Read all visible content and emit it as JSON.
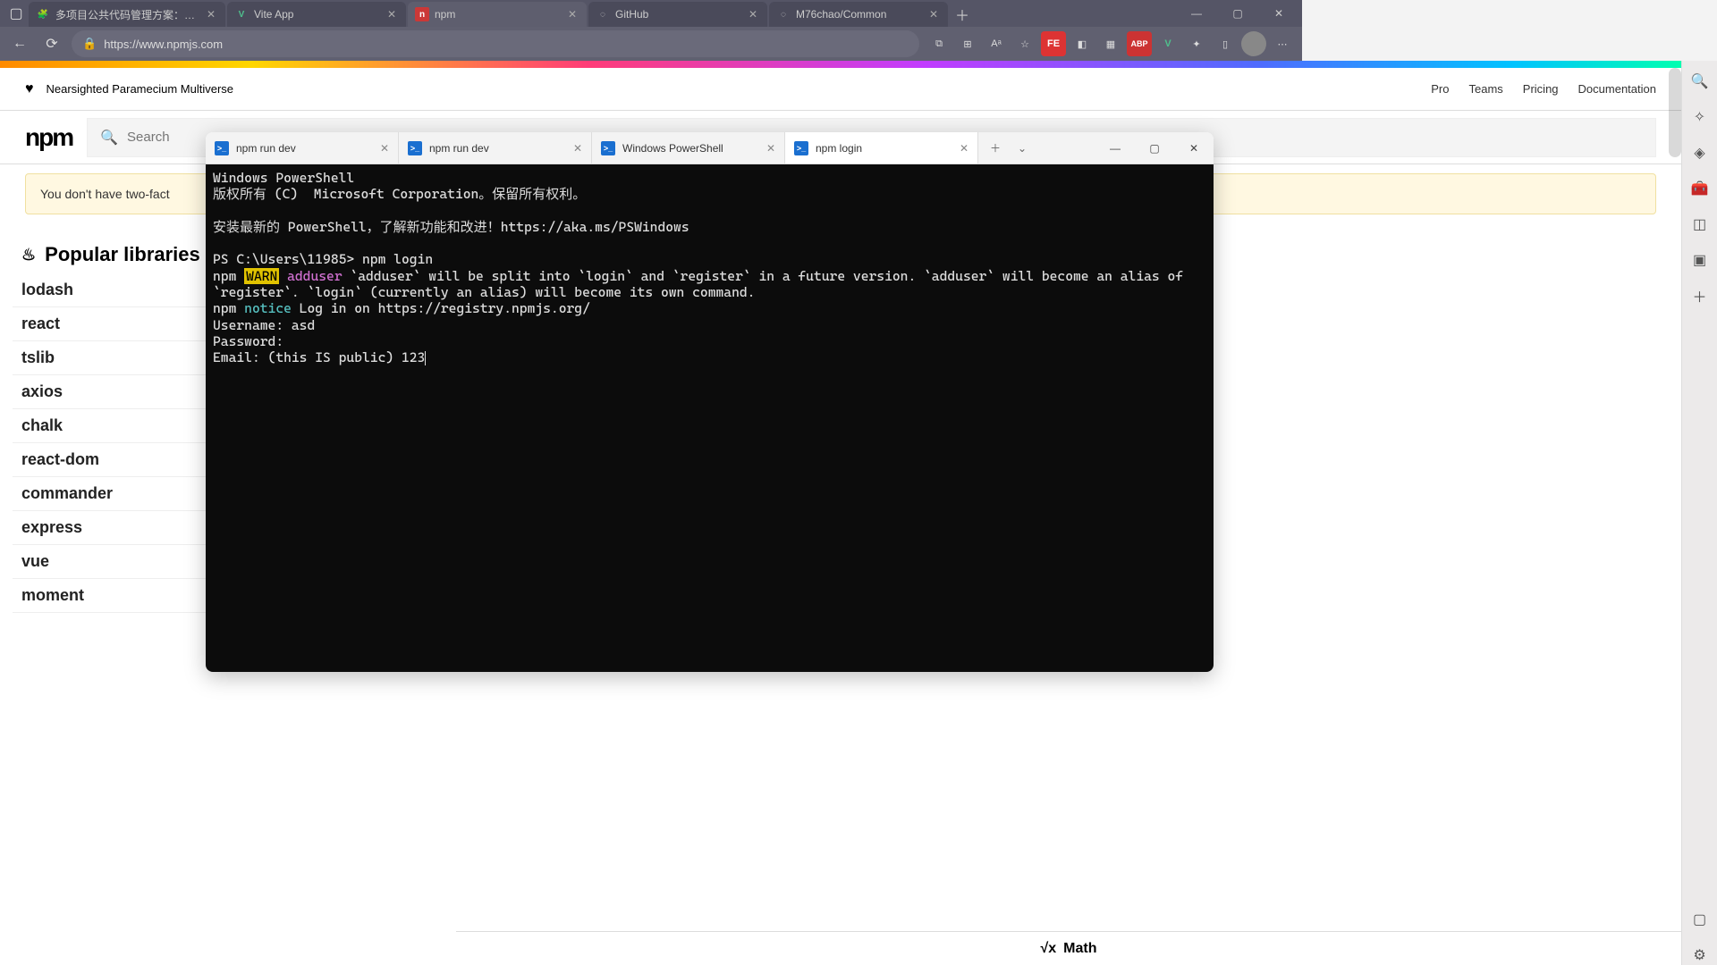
{
  "browser": {
    "tabs": [
      {
        "title": "多项目公共代码管理方案：git su",
        "favicon": "🧩"
      },
      {
        "title": "Vite App",
        "favicon": "V"
      },
      {
        "title": "npm",
        "favicon": "n",
        "active": true
      },
      {
        "title": "GitHub",
        "favicon": "◌"
      },
      {
        "title": "M76chao/Common",
        "favicon": "◌"
      }
    ],
    "url": "https://www.npmjs.com"
  },
  "npm": {
    "tagline": "Nearsighted Paramecium Multiverse",
    "nav": {
      "pro": "Pro",
      "teams": "Teams",
      "pricing": "Pricing",
      "docs": "Documentation"
    },
    "logo": "npm",
    "search_placeholder": "Search",
    "notice": "You don't have two-fact",
    "popular_heading": "Popular libraries",
    "libraries": [
      "lodash",
      "react",
      "tslib",
      "axios",
      "chalk",
      "react-dom",
      "commander",
      "express",
      "vue",
      "moment"
    ],
    "math": "Math"
  },
  "terminal": {
    "tabs": [
      {
        "title": "npm run dev"
      },
      {
        "title": "npm run dev"
      },
      {
        "title": "Windows PowerShell"
      },
      {
        "title": "npm login",
        "active": true
      }
    ],
    "lines": {
      "l1": "Windows PowerShell",
      "l2": "版权所有 (C)  Microsoft Corporation。保留所有权利。",
      "l3_a": "安装最新的 PowerShell，了解新功能和改进！",
      "l3_b": "https://aka.ms/PSWindows",
      "prompt": "PS C:\\Users\\11985> ",
      "cmd": "npm login",
      "warn_pre": "npm ",
      "warn_tag": "WARN",
      "warn_key": " adduser",
      "warn_msg": " `adduser` will be split into `login` and `register` in a future version. `adduser` will become an alias of `register`. `login` (currently an alias) will become its own command.",
      "notice_pre": "npm ",
      "notice_tag": "notice",
      "notice_msg": " Log in on https://registry.npmjs.org/",
      "user_label": "Username: ",
      "user_val": "asd",
      "pass_label": "Password:",
      "email_label": "Email: (this IS public) ",
      "email_val": "123"
    }
  }
}
